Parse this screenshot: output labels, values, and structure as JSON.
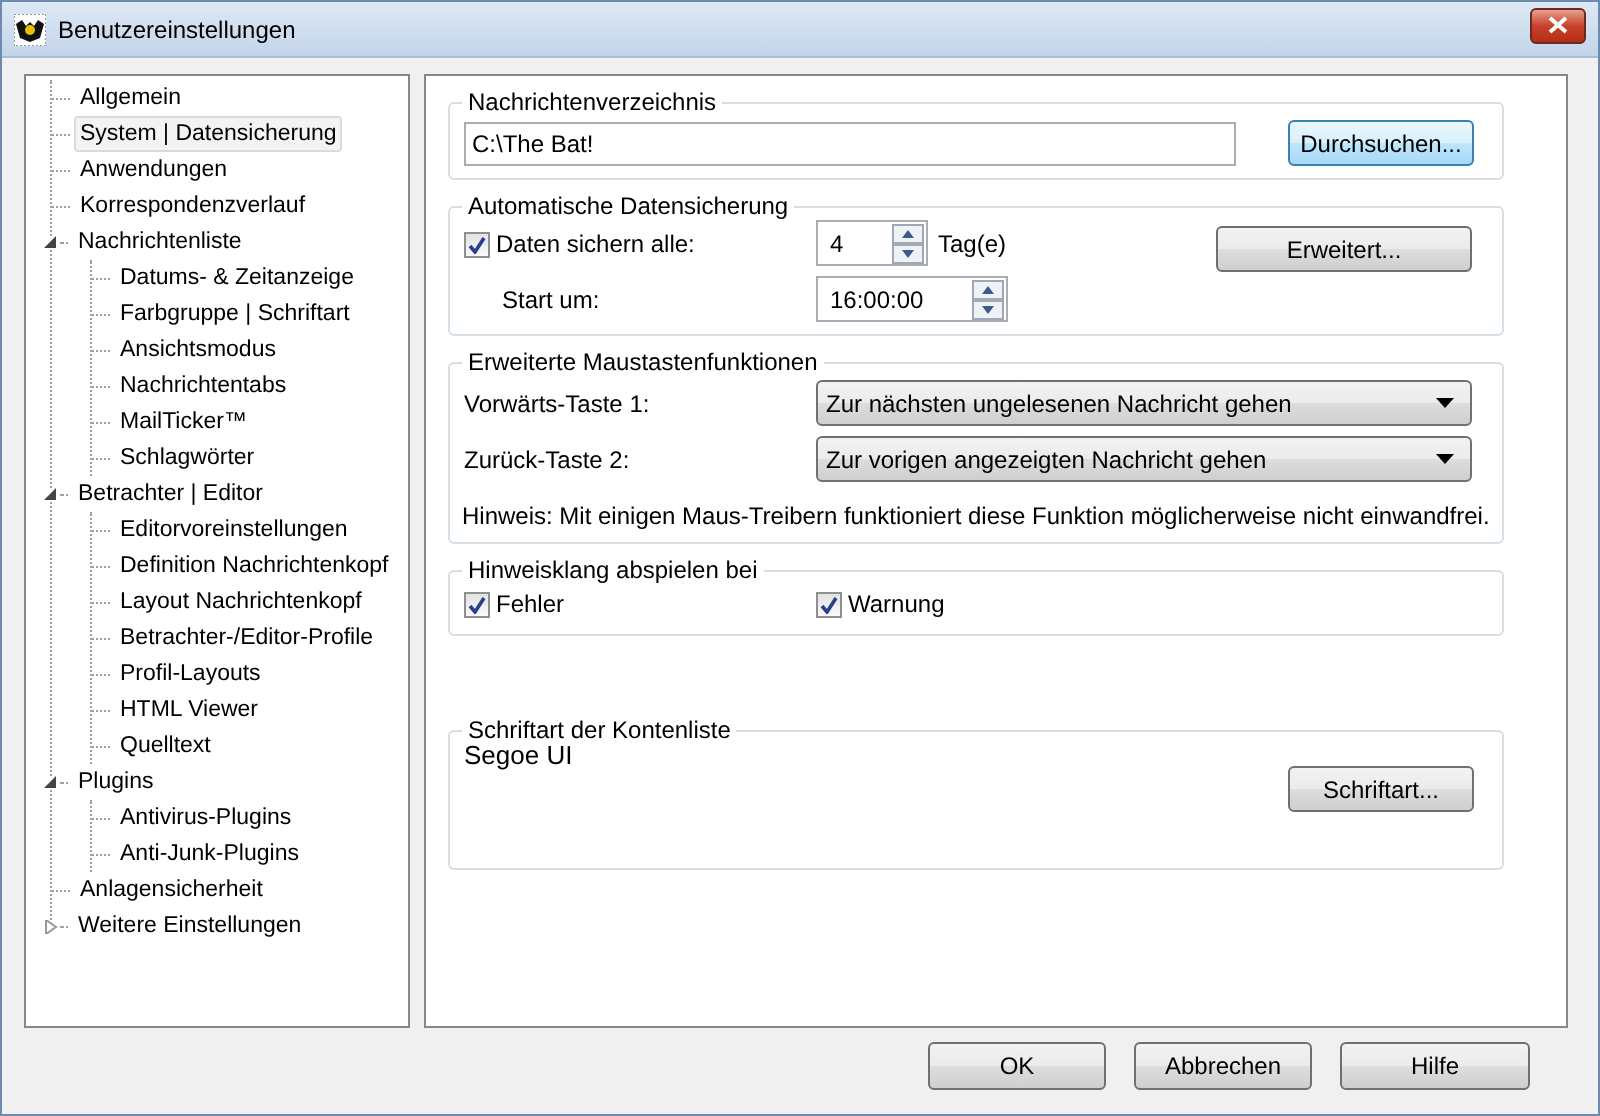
{
  "window": {
    "title": "Benutzereinstellungen"
  },
  "tree": [
    {
      "label": "Allgemein",
      "selected": false
    },
    {
      "label": "System | Datensicherung",
      "selected": true
    },
    {
      "label": "Anwendungen",
      "selected": false
    },
    {
      "label": "Korrespondenzverlauf",
      "selected": false
    },
    {
      "label": "Nachrichtenliste",
      "selected": false,
      "expanded": true,
      "children": [
        {
          "label": "Datums- & Zeitanzeige",
          "selected": false
        },
        {
          "label": "Farbgruppe | Schriftart",
          "selected": false
        },
        {
          "label": "Ansichtsmodus",
          "selected": false
        },
        {
          "label": "Nachrichtentabs",
          "selected": false
        },
        {
          "label": "MailTicker™",
          "selected": false
        },
        {
          "label": "Schlagwörter",
          "selected": false
        }
      ]
    },
    {
      "label": "Betrachter | Editor",
      "selected": false,
      "expanded": true,
      "children": [
        {
          "label": "Editorvoreinstellungen",
          "selected": false
        },
        {
          "label": "Definition Nachrichtenkopf",
          "selected": false
        },
        {
          "label": "Layout Nachrichtenkopf",
          "selected": false
        },
        {
          "label": "Betrachter-/Editor-Profile",
          "selected": false
        },
        {
          "label": "Profil-Layouts",
          "selected": false
        },
        {
          "label": "HTML Viewer",
          "selected": false
        },
        {
          "label": "Quelltext",
          "selected": false
        }
      ]
    },
    {
      "label": "Plugins",
      "selected": false,
      "expanded": true,
      "children": [
        {
          "label": "Antivirus-Plugins",
          "selected": false
        },
        {
          "label": "Anti-Junk-Plugins",
          "selected": false
        }
      ]
    },
    {
      "label": "Anlagensicherheit",
      "selected": false
    },
    {
      "label": "Weitere Einstellungen",
      "selected": false,
      "expanded": false
    }
  ],
  "message_folder": {
    "legend": "Nachrichtenverzeichnis",
    "value": "C:\\The Bat!",
    "button": "Durchsuchen..."
  },
  "auto_backup": {
    "legend": "Automatische Datensicherung",
    "checkbox": {
      "label": "Daten sichern alle:",
      "checked": true
    },
    "days": "4",
    "days_unit": "Tag(e)",
    "start_label": "Start um:",
    "start_time": "16:00:00",
    "button": "Erweitert..."
  },
  "mouse_buttons": {
    "legend": "Erweiterte Maustastenfunktionen",
    "rows": [
      {
        "label": "Vorwärts-Taste 1:",
        "value": "Zur nächsten ungelesenen Nachricht gehen"
      },
      {
        "label": "Zurück-Taste 2:",
        "value": "Zur vorigen angezeigten Nachricht gehen"
      }
    ],
    "note": "Hinweis: Mit einigen Maus-Treibern funktioniert diese Funktion möglicherweise nicht einwandfrei."
  },
  "sound": {
    "legend": "Hinweisklang abspielen bei",
    "checkboxes": [
      {
        "label": "Fehler",
        "checked": true
      },
      {
        "label": "Warnung",
        "checked": true
      }
    ]
  },
  "font": {
    "legend": "Schriftart der Kontenliste",
    "value": "Segoe UI",
    "button": "Schriftart..."
  },
  "buttons": [
    "OK",
    "Abbrechen",
    "Hilfe"
  ]
}
